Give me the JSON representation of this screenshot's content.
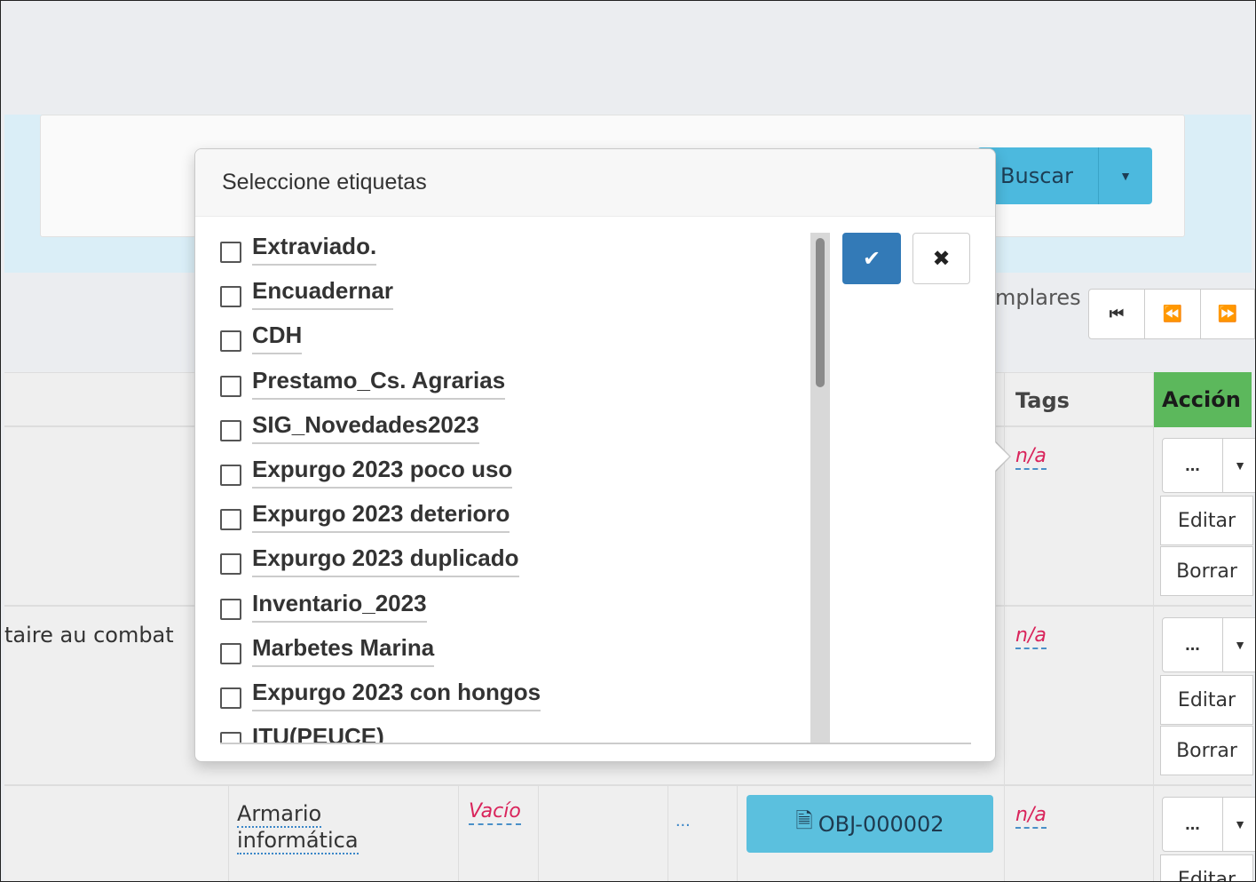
{
  "search": {
    "button_label": "Buscar",
    "caret": "▾"
  },
  "pager": {
    "partial_label": "mplares",
    "first": "⏮",
    "prev": "⏪",
    "next": "⏩"
  },
  "table": {
    "headers": {
      "tags": "Tags",
      "accion": "Acción"
    },
    "rows": [
      {
        "tags": "n/a",
        "title_fragment": "",
        "actions": {
          "dots": "...",
          "edit": "Editar",
          "delete": "Borrar"
        }
      },
      {
        "tags": "n/a",
        "title_fragment": "taire au combat",
        "actions": {
          "dots": "...",
          "edit": "Editar",
          "delete": "Borrar"
        }
      },
      {
        "tags": "n/a",
        "location_line1": "Armario",
        "location_line2": "informática",
        "status": "Vacío",
        "ellipsis": "...",
        "object_code": "OBJ-000002",
        "actions": {
          "dots": "...",
          "edit": "Editar"
        }
      }
    ]
  },
  "popover": {
    "title": "Seleccione etiquetas",
    "confirm_icon": "check-icon",
    "cancel_icon": "close-icon",
    "tags": [
      "Extraviado.",
      "Encuadernar",
      "CDH",
      "Prestamo_Cs. Agrarias",
      "SIG_Novedades2023",
      "Expurgo 2023 poco uso",
      "Expurgo 2023 deterioro",
      "Expurgo 2023 duplicado",
      "Inventario_2023",
      "Marbetes Marina",
      "Expurgo 2023 con hongos",
      "ITU(PEUCE)"
    ]
  },
  "colors": {
    "primary": "#337ab7",
    "info": "#5bc0de",
    "success": "#5cb85c",
    "danger_text": "#d9245b"
  }
}
